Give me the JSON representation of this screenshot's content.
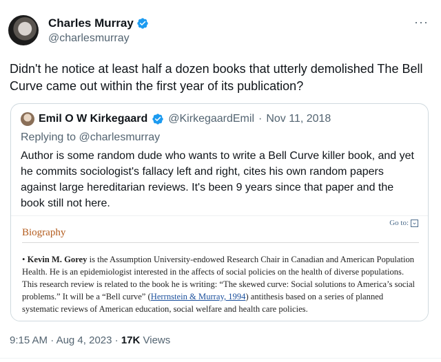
{
  "author": {
    "name": "Charles Murray",
    "handle": "@charlesmurray",
    "verified": true
  },
  "more_label": "···",
  "tweet_text": "Didn't he notice at least half a dozen books that utterly demolished The Bell Curve came out within the first year of its publication?",
  "quote": {
    "name": "Emil O W Kirkegaard",
    "handle": "@KirkegaardEmil",
    "separator": "·",
    "date": "Nov 11, 2018",
    "replying_to": "Replying to @charlesmurray",
    "text": "Author is some random dude who wants to write a Bell Curve killer book, and yet he commits sociologist's fallacy left and right, cites his own random papers against large hereditarian reviews. It's been 9 years since that paper and the book still not here.",
    "image": {
      "goto_label": "Go to:",
      "goto_icon": "chevron-down-icon",
      "section_title": "Biography",
      "bullet": "•",
      "bio_name": "Kevin M. Gorey",
      "bio_part1": " is the Assumption University-endowed Research Chair in Canadian and American Population Health. He is an epidemiologist interested in the affects of social policies on the health of diverse populations. This research review is related to the book he is writing: “The skewed curve: Social solutions to America’s social problems.” It will be a “Bell curve” (",
      "bio_link": "Herrnstein & Murray, 1994",
      "bio_part2": ") antithesis based on a series of planned systematic reviews of American education, social welfare and health care policies."
    }
  },
  "timestamp": {
    "time": "9:15 AM",
    "separator": "·",
    "date": "Aug 4, 2023",
    "separator2": "·",
    "views_count": "17K",
    "views_label": "Views"
  },
  "colors": {
    "verified_blue": "#1d9bf0",
    "secondary_text": "#536471",
    "section_title": "#b35c1e"
  }
}
